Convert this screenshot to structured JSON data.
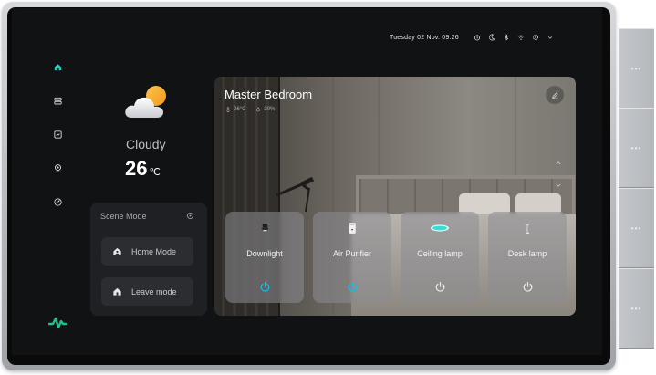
{
  "status_bar": {
    "datetime": "Tuesday 02 Nov. 09:26",
    "icons": [
      "alarm-icon",
      "moon-icon",
      "bluetooth-icon",
      "wifi-icon",
      "settings-icon",
      "chevron-down-icon"
    ]
  },
  "nav": {
    "items": [
      {
        "name": "home-icon",
        "active": true
      },
      {
        "name": "devices-icon",
        "active": false
      },
      {
        "name": "scenes-icon",
        "active": false
      },
      {
        "name": "camera-icon",
        "active": false
      },
      {
        "name": "energy-icon",
        "active": false
      }
    ]
  },
  "weather": {
    "condition": "Cloudy",
    "temperature": "26",
    "unit": "℃",
    "icon": "partly-cloudy-icon"
  },
  "scene_mode": {
    "title": "Scene Mode",
    "modes": [
      {
        "label": "Home Mode",
        "icon": "home-mode-icon"
      },
      {
        "label": "Leave mode",
        "icon": "leave-mode-icon"
      }
    ]
  },
  "room": {
    "name": "Master Bedroom",
    "temperature": "26°C",
    "humidity": "30%",
    "devices": [
      {
        "name": "Downlight",
        "icon": "downlight-icon",
        "on": true
      },
      {
        "name": "Air Purifier",
        "icon": "air-purifier-icon",
        "on": true
      },
      {
        "name": "Ceiling lamp",
        "icon": "ceiling-lamp-icon",
        "on": false
      },
      {
        "name": "Desk lamp",
        "icon": "desk-lamp-icon",
        "on": false
      }
    ]
  },
  "colors": {
    "accent": "#1fd1c4",
    "brand": "#22c28e",
    "power_off": "#e8e8e8",
    "power_on": "#1fb9e0"
  }
}
